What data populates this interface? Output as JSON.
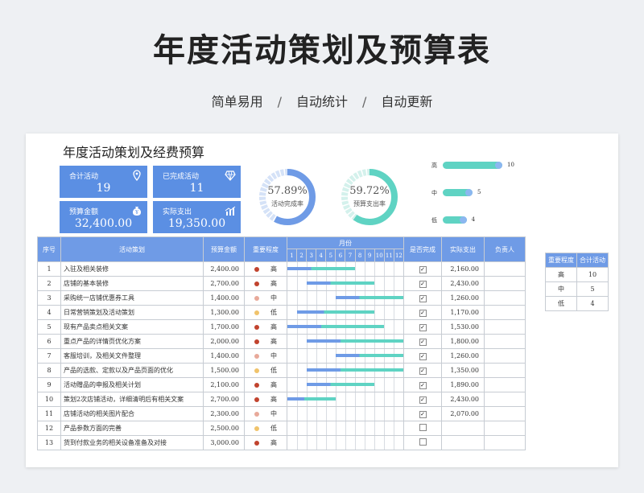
{
  "header": {
    "title": "年度活动策划及预算表",
    "features": [
      "简单易用",
      "自动统计",
      "自动更新"
    ],
    "separator": "/"
  },
  "sheet": {
    "title": "年度活动策划及经费预算",
    "cards": [
      {
        "label": "合计活动",
        "value": "19",
        "icon": "location-pin-icon"
      },
      {
        "label": "已完成活动",
        "value": "11",
        "icon": "diamond-icon"
      },
      {
        "label": "预算金额",
        "value": "32,400.00",
        "icon": "money-bag-icon"
      },
      {
        "label": "实际支出",
        "value": "19,350.00",
        "icon": "bar-chart-icon"
      }
    ],
    "donuts": [
      {
        "percent": "57.89%",
        "label": "活动完成率",
        "fraction": 0.5789,
        "color": "#6f9be6"
      },
      {
        "percent": "59.72%",
        "label": "预算支出率",
        "fraction": 0.5972,
        "color": "#5fd3c3"
      }
    ],
    "priority_bars": [
      {
        "label": "高",
        "value": "10",
        "fraction": 1.0
      },
      {
        "label": "中",
        "value": "5",
        "fraction": 0.5
      },
      {
        "label": "低",
        "value": "4",
        "fraction": 0.4
      }
    ],
    "table": {
      "headers": {
        "no": "序号",
        "activity": "活动策划",
        "budget": "预算金额",
        "priority": "重要程度",
        "month": "月份",
        "done": "是否完成",
        "actual": "实际支出",
        "owner": "负责人"
      },
      "months": [
        "1",
        "2",
        "3",
        "4",
        "5",
        "6",
        "7",
        "8",
        "9",
        "10",
        "11",
        "12"
      ],
      "rows": [
        {
          "no": "1",
          "activity": "入驻及相关装修",
          "budget": "2,400.00",
          "priority": "高",
          "start": 1,
          "end": 7,
          "done": true,
          "actual": "2,160.00"
        },
        {
          "no": "2",
          "activity": "店铺的基本装修",
          "budget": "2,700.00",
          "priority": "高",
          "start": 3,
          "end": 9,
          "done": true,
          "actual": "2,430.00"
        },
        {
          "no": "3",
          "activity": "采购统一店铺优惠券工具",
          "budget": "1,400.00",
          "priority": "中",
          "start": 6,
          "end": 12,
          "done": true,
          "actual": "1,260.00"
        },
        {
          "no": "4",
          "activity": "日常营销策划及活动策划",
          "budget": "1,300.00",
          "priority": "低",
          "start": 2,
          "end": 9,
          "done": true,
          "actual": "1,170.00"
        },
        {
          "no": "5",
          "activity": "现有产品卖点相关文案",
          "budget": "1,700.00",
          "priority": "高",
          "start": 1,
          "end": 10,
          "done": true,
          "actual": "1,530.00"
        },
        {
          "no": "6",
          "activity": "重点产品的详情页优化方案",
          "budget": "2,000.00",
          "priority": "高",
          "start": 3,
          "end": 12,
          "done": true,
          "actual": "1,800.00"
        },
        {
          "no": "7",
          "activity": "客服培训，及相关文件整理",
          "budget": "1,400.00",
          "priority": "中",
          "start": 6,
          "end": 12,
          "done": true,
          "actual": "1,260.00"
        },
        {
          "no": "8",
          "activity": "产品的选款、定款以及产品页面的优化",
          "budget": "1,500.00",
          "priority": "低",
          "start": 3,
          "end": 12,
          "done": true,
          "actual": "1,350.00"
        },
        {
          "no": "9",
          "activity": "活动赠品的申报及相关计划",
          "budget": "2,100.00",
          "priority": "高",
          "start": 3,
          "end": 9,
          "done": true,
          "actual": "1,890.00"
        },
        {
          "no": "10",
          "activity": "策划2次店铺活动，详细清明后有相关文案",
          "budget": "2,700.00",
          "priority": "高",
          "start": 1,
          "end": 5,
          "done": true,
          "actual": "2,430.00"
        },
        {
          "no": "11",
          "activity": "店铺活动的相关图片配合",
          "budget": "2,300.00",
          "priority": "中",
          "start": 0,
          "end": 0,
          "done": true,
          "actual": "2,070.00"
        },
        {
          "no": "12",
          "activity": "产品参数方面的完善",
          "budget": "2,500.00",
          "priority": "低",
          "start": 0,
          "end": 0,
          "done": false,
          "actual": ""
        },
        {
          "no": "13",
          "activity": "货到付款业务的相关设备准备及对接",
          "budget": "3,000.00",
          "priority": "高",
          "start": 0,
          "end": 0,
          "done": false,
          "actual": ""
        }
      ]
    },
    "side_table": {
      "headers": [
        "重要程度",
        "合计活动"
      ],
      "rows": [
        [
          "高",
          "10"
        ],
        [
          "中",
          "5"
        ],
        [
          "低",
          "4"
        ]
      ]
    },
    "colors": {
      "high": "#c1432e",
      "mid": "#e8a99a",
      "low": "#f0c36b",
      "header": "#6f9be6",
      "bar_blue": "#6f9be6",
      "bar_teal": "#5fd3c3"
    }
  }
}
